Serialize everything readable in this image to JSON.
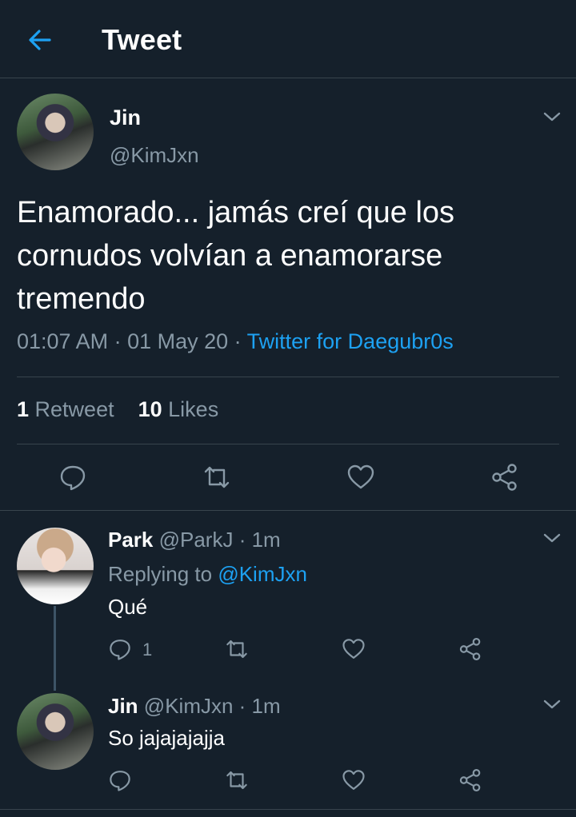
{
  "colors": {
    "background": "#15202b",
    "accent": "#1da1f2",
    "secondary_text": "#8899a6",
    "divider": "#38444d"
  },
  "header": {
    "title": "Tweet",
    "back_icon": "arrow-left-icon"
  },
  "main_tweet": {
    "name": "Jin",
    "handle": "@KimJxn",
    "text": "Enamorado... jamás creí que los\ncornudos volvían a enamorarse\ntremendo",
    "time": "01:07 AM · 01 May 20 · ",
    "source": "Twitter for Daegubr0s",
    "retweets_count": "1",
    "retweets_label": " Retweet",
    "likes_count": "10",
    "likes_label": " Likes",
    "actions": [
      "reply-icon",
      "retweet-icon",
      "like-icon",
      "share-icon"
    ]
  },
  "replies": [
    {
      "name": "Park",
      "handle_time": " @ParkJ · 1m",
      "replying_prefix": "Replying to ",
      "replying_to": "@KimJxn",
      "text": "Qué",
      "reply_count": "1"
    },
    {
      "name": "Jin",
      "handle_time": " @KimJxn · 1m",
      "text": "So jajajajajja"
    }
  ]
}
